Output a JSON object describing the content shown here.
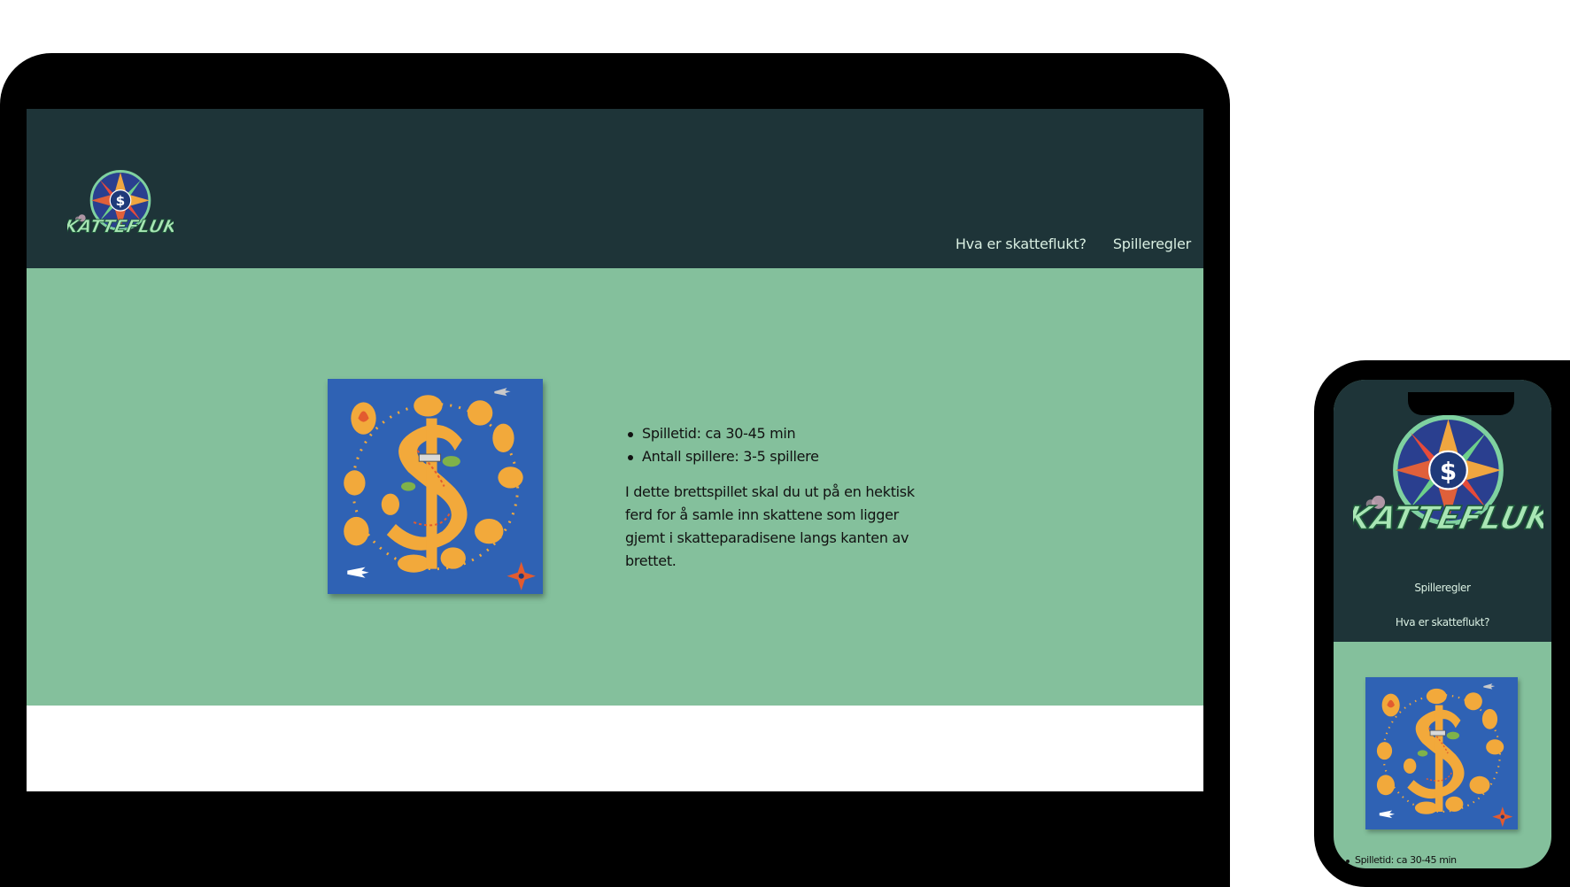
{
  "brand": {
    "logo_text": "SKATTEFLUKT",
    "logo_symbol": "$"
  },
  "tablet": {
    "nav": [
      {
        "label": "Hva er skatteflukt?"
      },
      {
        "label": "Spilleregler"
      }
    ],
    "facts": [
      {
        "text": "Spilletid: ca 30-45 min"
      },
      {
        "text": "Antall spillere: 3-5 spillere"
      }
    ],
    "description": "I dette brettspillet skal du ut på en hektisk ferd for å samle inn skattene som ligger gjemt i skatteparadisene langs kanten av brettet."
  },
  "phone": {
    "nav": [
      {
        "label": "Spilleregler"
      },
      {
        "label": "Hva er skatteflukt?"
      }
    ],
    "facts": [
      {
        "text": "Spilletid: ca 30-45 min"
      }
    ]
  },
  "colors": {
    "header_bg": "#1e3438",
    "main_bg": "#84c09c",
    "board_blue": "#2f62b4",
    "island_orange": "#f2a93b",
    "nav_text": "#d9efe2",
    "logo_green": "#a8e6b4"
  },
  "icons": {
    "logo": "compass-star-dollar-logo",
    "board": "treasure-map-board-icon"
  }
}
